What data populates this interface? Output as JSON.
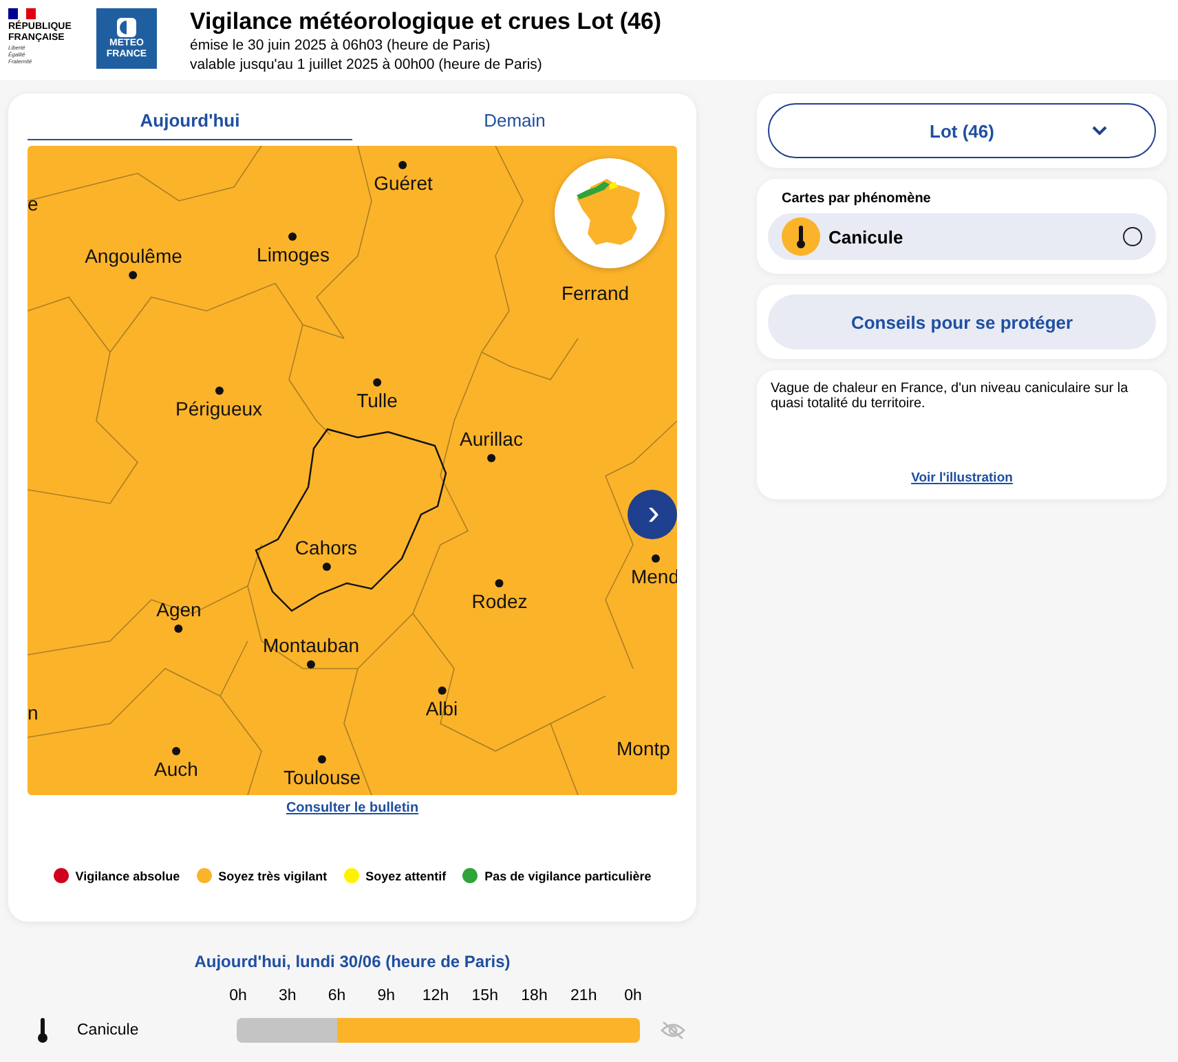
{
  "header": {
    "logo_republique": [
      "RÉPUBLIQUE",
      "FRANÇAISE"
    ],
    "motto": [
      "Liberté",
      "Égalité",
      "Fraternité"
    ],
    "logo_meteo": [
      "METEO",
      "FRANCE"
    ],
    "title": "Vigilance météorologique et crues Lot (46)",
    "issued": "émise le 30 juin 2025 à 06h03 (heure de Paris)",
    "valid": "valable jusqu'au 1 juillet 2025 à 00h00 (heure de Paris)"
  },
  "tabs": [
    {
      "label": "Aujourd'hui",
      "selected": true
    },
    {
      "label": "Demain",
      "selected": false
    }
  ],
  "map": {
    "cities": [
      {
        "name": "e",
        "dot": false
      },
      {
        "name": "Guéret",
        "dot": true
      },
      {
        "name": "Angoulême",
        "dot": true
      },
      {
        "name": "Limoges",
        "dot": true
      },
      {
        "name": "Ferrand",
        "dot": false
      },
      {
        "name": "Tulle",
        "dot": true
      },
      {
        "name": "Périgueux",
        "dot": true
      },
      {
        "name": "Aurillac",
        "dot": true
      },
      {
        "name": "Cahors",
        "dot": true
      },
      {
        "name": "Agen",
        "dot": true
      },
      {
        "name": "Rodez",
        "dot": true
      },
      {
        "name": "Mend",
        "dot": true
      },
      {
        "name": "Montauban",
        "dot": true
      },
      {
        "name": "Albi",
        "dot": true
      },
      {
        "name": "n",
        "dot": false
      },
      {
        "name": "Auch",
        "dot": true
      },
      {
        "name": "Toulouse",
        "dot": true
      },
      {
        "name": "Montp",
        "dot": false
      }
    ],
    "next_button": "›",
    "bulletin_link": "Consulter le bulletin"
  },
  "legend": [
    {
      "label": "Vigilance absolue",
      "color": "#d0021b"
    },
    {
      "label": "Soyez très vigilant",
      "color": "#fbb32a"
    },
    {
      "label": "Soyez attentif",
      "color": "#fff200"
    },
    {
      "label": "Pas de vigilance particulière",
      "color": "#2ea43a"
    }
  ],
  "timeline": {
    "title": "Aujourd'hui, lundi 30/06 (heure de Paris)",
    "hours": [
      "0h",
      "3h",
      "6h",
      "9h",
      "12h",
      "15h",
      "18h",
      "21h",
      "0h"
    ],
    "rows": [
      {
        "label": "Canicule",
        "level": 0.75
      }
    ]
  },
  "sidebar": {
    "department": "Lot (46)",
    "maps_title": "Cartes par phénomène",
    "phenomena": [
      {
        "label": "Canicule",
        "selected": false
      }
    ],
    "advice_button": "Conseils pour se protéger",
    "description": "Vague de chaleur en France, d'un niveau caniculaire sur la quasi totalité du territoire.",
    "illustration_link": "Voir l'illustration"
  }
}
